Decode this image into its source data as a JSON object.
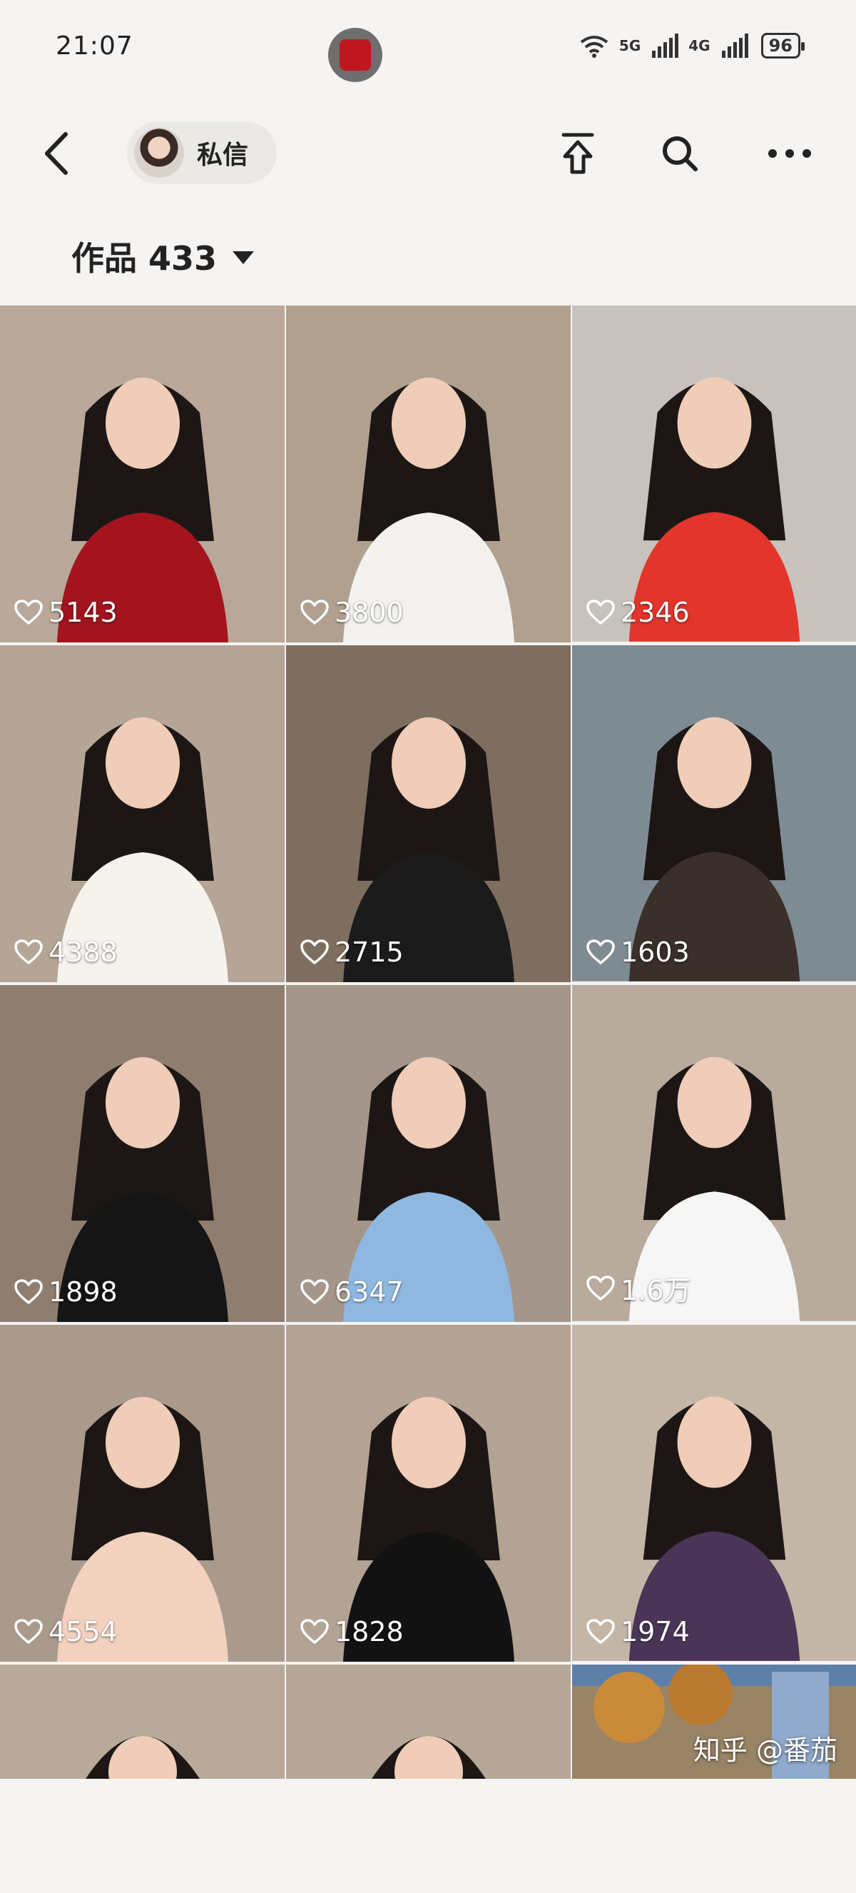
{
  "status_bar": {
    "time": "21:07",
    "network_a": "5G",
    "network_b": "4G",
    "battery": "96"
  },
  "header": {
    "message_label": "私信",
    "icons": [
      "back-icon",
      "share-icon",
      "search-icon",
      "more-icon"
    ]
  },
  "works": {
    "label": "作品 433"
  },
  "grid": {
    "tiles": [
      {
        "likes": "5143",
        "bg": "#b9a89a",
        "outfit": "#a3141f"
      },
      {
        "likes": "3800",
        "bg": "#b0a08f",
        "outfit": "#f3f2ef"
      },
      {
        "likes": "2346",
        "bg": "#c7c2bb",
        "outfit": "#e2352c"
      },
      {
        "likes": "4388",
        "bg": "#b5a596",
        "outfit": "#f6f3ee"
      },
      {
        "likes": "2715",
        "bg": "#7e6e60",
        "outfit": "#1b1b1b"
      },
      {
        "likes": "1603",
        "bg": "#7f8b93",
        "outfit": "#3a2f2b"
      },
      {
        "likes": "1898",
        "bg": "#8f7e70",
        "outfit": "#151515"
      },
      {
        "likes": "6347",
        "bg": "#a4968a",
        "outfit": "#8fb8e0"
      },
      {
        "likes": "1.6万",
        "bg": "#b8aa9c",
        "outfit": "#f6f6f6"
      },
      {
        "likes": "4554",
        "bg": "#a99a8c",
        "outfit": "#f3d1bf"
      },
      {
        "likes": "1828",
        "bg": "#b2a394",
        "outfit": "#121212"
      },
      {
        "likes": "1974",
        "bg": "#c4b6a7",
        "outfit": "#4a3557"
      }
    ],
    "partial_tiles": [
      {
        "bg": "#b8a99b"
      },
      {
        "bg": "#b6a798"
      },
      {
        "bg": "#9a8466"
      }
    ]
  },
  "watermark": "知乎 @番茄"
}
